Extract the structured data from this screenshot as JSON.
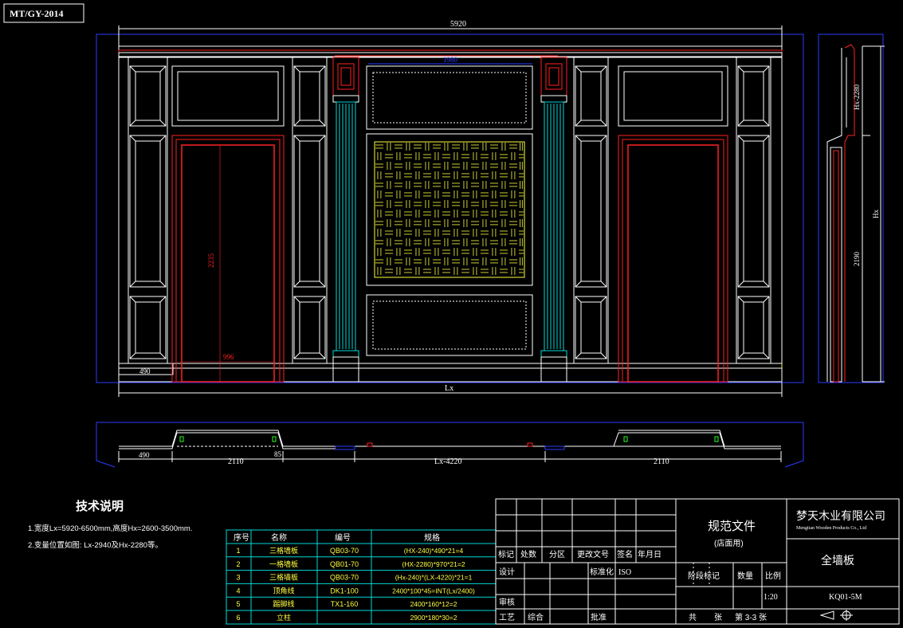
{
  "drawing_code": "MT/GY-2014",
  "dims": {
    "total_width": "5920",
    "section_height": "Hx-2280",
    "section_total": "Hx",
    "section_lower": "2190",
    "door_height": "2235",
    "door_width": "996",
    "base_left": "490",
    "overall": "Lx",
    "top_center": "1980",
    "plan_left": "490",
    "plan_seg1": "2110",
    "plan_small": "85",
    "plan_mid": "Lx-4220",
    "plan_seg2": "2110"
  },
  "notes": {
    "title": "技术说明",
    "line1": "1.宽度Lx=5920-6500mm,高度Hx=2600-3500mm.",
    "line2": "2.变量位置如图: Lx-2940及Hx-2280等。"
  },
  "bom": {
    "headers": [
      "序号",
      "名称",
      "编号",
      "规格"
    ],
    "rows": [
      [
        "1",
        "三格墙板",
        "QB03-70",
        "(HX-240)*490*21=4"
      ],
      [
        "2",
        "一格墙板",
        "QB01-70",
        "(HX-2280)*970*21=2"
      ],
      [
        "3",
        "三格墙板",
        "QB03-70",
        "(Hx-240)*(LX-4220)*21=1"
      ],
      [
        "4",
        "顶角线",
        "DK1-100",
        "2400*100*45=INT(Lx/2400)"
      ],
      [
        "5",
        "踢脚线",
        "TX1-160",
        "2400*160*12=2"
      ],
      [
        "6",
        "立柱",
        "",
        "2900*180*30=2"
      ]
    ]
  },
  "title_block": {
    "labels": {
      "biaoji": "标记",
      "chushu": "处数",
      "fenqu": "分区",
      "gengai": "更改文号",
      "qianming": "签名",
      "nianyueri": "年月日",
      "sheji": "设计",
      "biaozhunhua": "标准化",
      "iso": "ISO",
      "shenhe": "审核",
      "gongyi": "工艺",
      "zonghe": "综合",
      "pizhun": "批准",
      "jieduan": "阶段标记",
      "shuliang": "数量",
      "bili": "比例"
    },
    "spec_title": "规范文件",
    "spec_sub": "(店面用)",
    "company_cn": "梦天木业有限公司",
    "company_en": "Mengtian Wooden Products Co., Ltd",
    "drawing_name": "全墙板",
    "scale": "1:20",
    "code": "KQ01-5M",
    "sheet_gong": "共",
    "sheet_zhang": "张",
    "sheet_no": "第 3-3 张"
  }
}
